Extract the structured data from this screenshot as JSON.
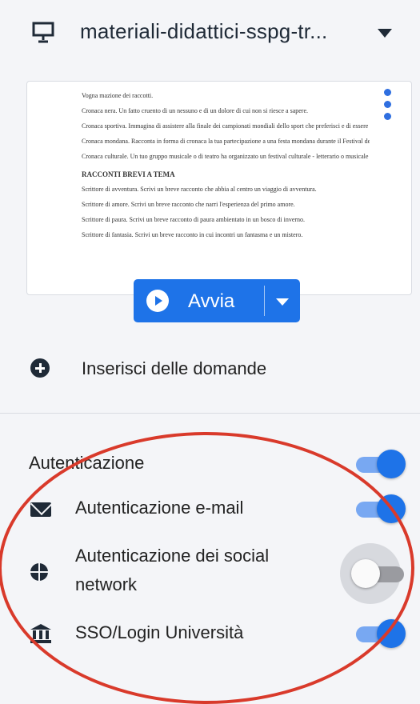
{
  "header": {
    "title": "materiali-didattici-sspg-tr..."
  },
  "preview": {
    "lines": [
      "Vogna mazione dei raccotti.",
      "Cronaca nera. Un fatto cruento di un nessuno e di un dolore di cui non si riesce a sapere.",
      "Cronaca sportiva. Immagina di assistere alla finale dei campionati mondiali dello sport che preferisci e di essere inviato/a per raccontare la giornata dei vincitori.",
      "Cronaca mondana. Racconta in forma di cronaca la tua partecipazione a una festa mondana durante il Festival del Cinema di Venezia.",
      "Cronaca culturale. Un tuo gruppo musicale o di teatro ha organizzato un festival culturale - letterario o musicale - da te preparato."
    ],
    "heading": "RACCONTI BREVI A TEMA",
    "bullets": [
      "Scrittore di avventura. Scrivi un breve racconto che abbia al centro un viaggio di avventura.",
      "Scrittore di amore. Scrivi un breve racconto che narri l'esperienza del primo amore.",
      "Scrittore di paura. Scrivi un breve racconto di paura ambientato in un bosco di inverno.",
      "Scrittore di fantasia. Scrivi un breve racconto in cui incontri un fantasma e un mistero."
    ]
  },
  "start_button": {
    "label": "Avvia"
  },
  "add_questions": {
    "label": "Inserisci delle domande"
  },
  "auth": {
    "section_label": "Autenticazione",
    "email_label": "Autenticazione e-mail",
    "social_label_line1": "Autenticazione dei social",
    "social_label_line2": "network",
    "sso_label": "SSO/Login Università"
  },
  "toggles": {
    "auth_enabled": true,
    "email_enabled": true,
    "social_enabled": false,
    "sso_enabled": true
  },
  "colors": {
    "accent": "#1e73e8",
    "annotation_circle": "#d93a2b"
  }
}
